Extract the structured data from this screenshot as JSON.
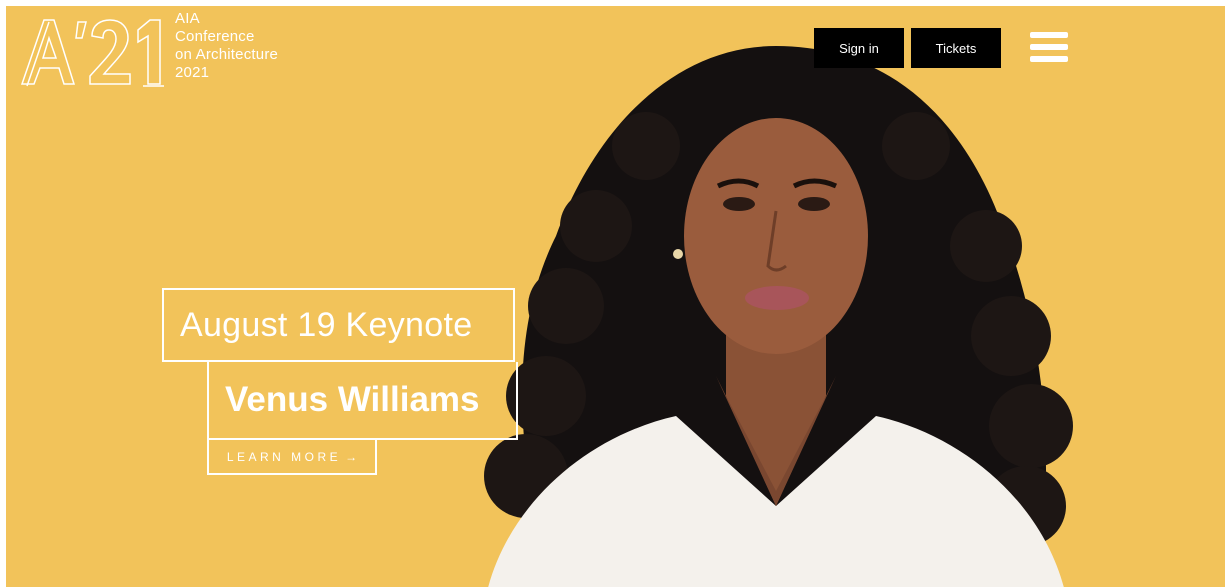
{
  "header": {
    "logo_lines": [
      "AIA",
      "Conference",
      "on Architecture",
      "2021"
    ],
    "signin_label": "Sign in",
    "tickets_label": "Tickets",
    "menu_icon": "hamburger-menu-icon"
  },
  "hero": {
    "keynote": "August 19 Keynote",
    "speaker": "Venus Williams",
    "cta_label": "LEARN MORE",
    "cta_arrow": "→",
    "background": "#f2c35a"
  },
  "colors": {
    "accent": "#f2c35a",
    "button_bg": "#000000",
    "text": "#ffffff"
  }
}
